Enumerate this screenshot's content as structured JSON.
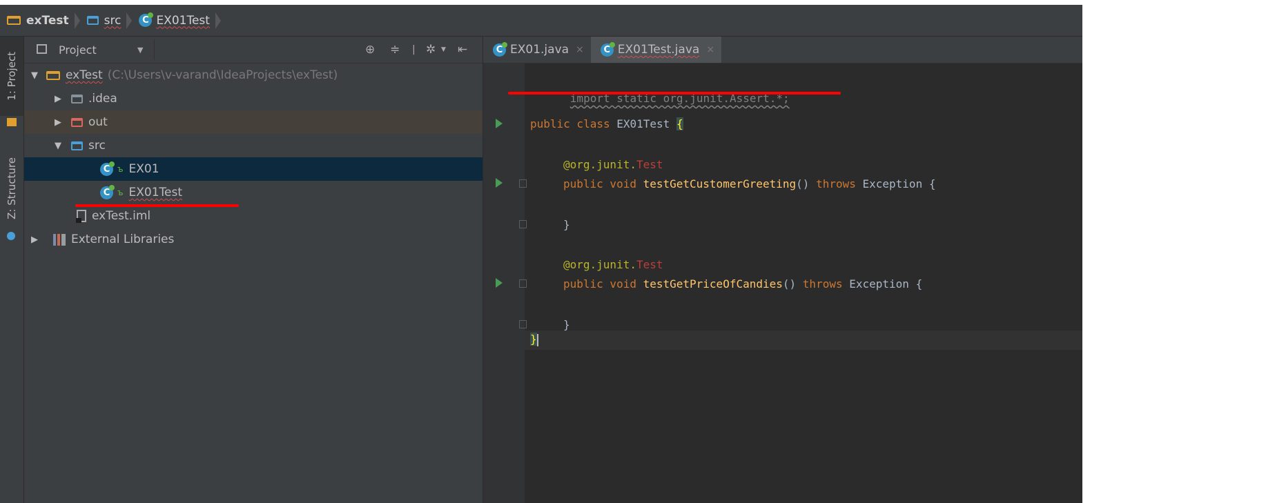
{
  "breadcrumb": {
    "project": "exTest",
    "folder": "src",
    "file": "EX01Test"
  },
  "sidebar_tabs": {
    "project": "1: Project",
    "structure": "Z: Structure"
  },
  "project_panel": {
    "view_selector": "Project",
    "tree": {
      "root_name": "exTest",
      "root_path": "(C:\\Users\\v-varand\\IdeaProjects\\exTest)",
      "idea": ".idea",
      "out": "out",
      "src": "src",
      "ex01": "EX01",
      "ex01test": "EX01Test",
      "iml": "exTest.iml",
      "libs": "External Libraries"
    }
  },
  "editor": {
    "tabs": [
      "EX01.java",
      "EX01Test.java"
    ],
    "close_symbol": "×",
    "code": {
      "import_line": "import static org.junit.Assert.*;",
      "class_kw": "public class ",
      "class_name": "EX01Test ",
      "brace_open": "{",
      "ann_prefix": "@org.junit.",
      "ann_name": "Test",
      "method_kw": "public void ",
      "method1": "testGetCustomerGreeting",
      "method2": "testGetPriceOfCandies",
      "parens": "() ",
      "throws_kw": "throws ",
      "exception": "Exception {",
      "brace_close": "}"
    }
  },
  "colors": {
    "annotation_red": "#ff0000",
    "selection": "#0d293e",
    "keyword": "#cc7832",
    "method": "#ffc66d"
  },
  "icons": [
    "module-folder-icon",
    "folder-icon",
    "test-class-icon",
    "locate-icon",
    "collapse-icon",
    "settings-icon",
    "hide-icon",
    "run-icon",
    "fold-icon"
  ]
}
